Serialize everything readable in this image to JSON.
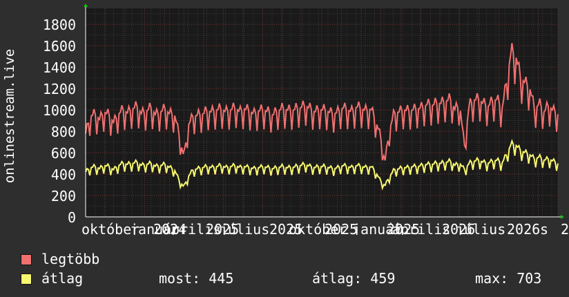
{
  "chart_data": {
    "type": "line",
    "ylabel": "onlinestream.live",
    "ylim": [
      0,
      1950
    ],
    "yticks": [
      0,
      200,
      400,
      600,
      800,
      1000,
      1200,
      1400,
      1600,
      1800
    ],
    "xticks": [
      "október",
      "január",
      "2024",
      "április",
      "2025",
      "július",
      "2025",
      "október",
      "2025",
      "január",
      "2025",
      "április",
      "2026",
      "július",
      "2026",
      "s",
      "2"
    ],
    "series": [
      {
        "name": "legtöbb",
        "color": "#f07070",
        "values": [
          780,
          940,
          960,
          910,
          980,
          950,
          880,
          960,
          1000,
          970,
          1010,
          1030,
          960,
          990,
          1020,
          950,
          980,
          1010,
          960,
          960,
          760,
          560,
          860,
          940,
          950,
          960,
          990,
          980,
          1000,
          1010,
          980,
          1000,
          1020,
          980,
          1010,
          990,
          960,
          990,
          1000,
          980,
          950,
          990,
          1010,
          1000,
          990,
          1010,
          1020,
          1040,
          1010,
          980,
          1000,
          1000,
          980,
          960,
          980,
          1020,
          1000,
          980,
          1030,
          1010,
          990,
          1010,
          900,
          760,
          510,
          820,
          970,
          980,
          1000,
          990,
          1000,
          1010,
          1020,
          1050,
          1040,
          1060,
          1060,
          1080,
          1100,
          1000,
          1050,
          650,
          1040,
          1090,
          1100,
          1060,
          1030,
          1080,
          1100,
          1000,
          1250,
          1550,
          1500,
          1300,
          1250,
          1200,
          1000,
          1060,
          980,
          1040,
          990,
          960
        ]
      },
      {
        "name": "átlag",
        "color": "#f8f870",
        "values": [
          420,
          460,
          470,
          450,
          480,
          470,
          440,
          480,
          500,
          490,
          500,
          510,
          480,
          490,
          500,
          470,
          480,
          490,
          460,
          440,
          340,
          280,
          380,
          440,
          450,
          460,
          470,
          460,
          470,
          480,
          460,
          470,
          480,
          460,
          470,
          460,
          450,
          460,
          470,
          460,
          450,
          460,
          470,
          460,
          460,
          470,
          480,
          490,
          470,
          460,
          470,
          470,
          460,
          450,
          460,
          480,
          470,
          460,
          480,
          470,
          460,
          470,
          420,
          340,
          290,
          380,
          440,
          450,
          460,
          460,
          470,
          470,
          480,
          490,
          490,
          500,
          500,
          510,
          520,
          480,
          500,
          440,
          500,
          520,
          530,
          510,
          500,
          520,
          530,
          500,
          580,
          680,
          670,
          620,
          600,
          580,
          540,
          560,
          530,
          540,
          520,
          500
        ]
      }
    ]
  },
  "legend": {
    "max_label": "legtöbb",
    "avg_label": "átlag",
    "now": "most: 445",
    "avg": "átlag: 459",
    "max": "max: 703"
  }
}
